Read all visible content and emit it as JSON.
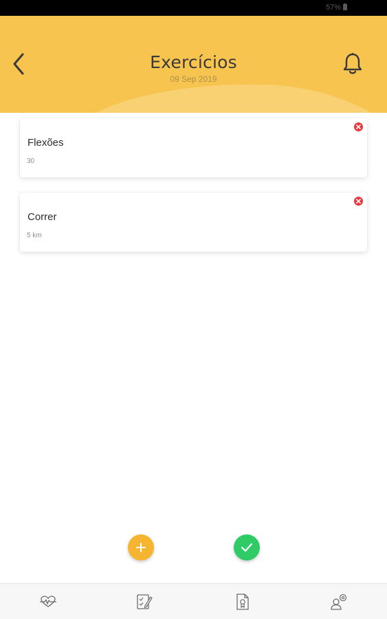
{
  "status_bar": {
    "battery_text": "57%"
  },
  "header": {
    "title": "Exercícios",
    "date": "09 Sep 2019",
    "accent_color": "#F7C44F",
    "back_icon": "chevron-left-icon",
    "notification_icon": "bell-icon"
  },
  "exercises": [
    {
      "name": "Flexões",
      "value": "30",
      "remove_icon": "close-circle-icon"
    },
    {
      "name": "Correr",
      "value": "5 km",
      "remove_icon": "close-circle-icon"
    }
  ],
  "actions": {
    "add_icon": "plus-icon",
    "add_color": "#F6B530",
    "confirm_icon": "check-icon",
    "confirm_color": "#2FCB67"
  },
  "bottom_nav": [
    {
      "icon": "heartbeat-icon"
    },
    {
      "icon": "edit-checklist-icon"
    },
    {
      "icon": "document-award-icon"
    },
    {
      "icon": "profile-settings-icon"
    }
  ]
}
